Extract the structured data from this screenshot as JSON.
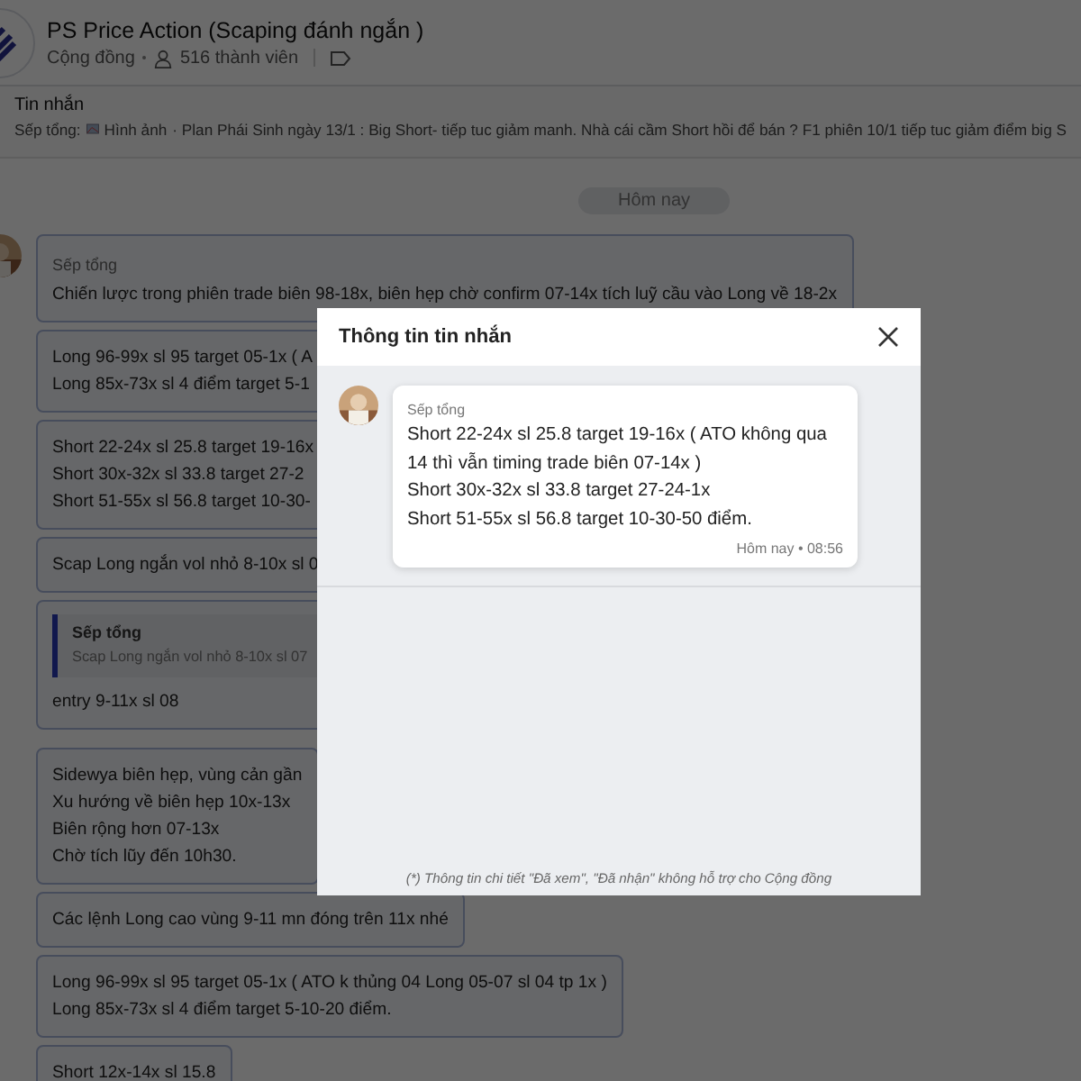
{
  "header": {
    "title": "PS Price Action (Scaping đánh ngắn )",
    "type": "Cộng đồng",
    "members": "516 thành viên"
  },
  "pinned": {
    "label": "Tin nhắn",
    "sender": "Sếp tổng:",
    "attachment": "Hình ảnh",
    "preview": "· Plan Phái Sinh ngày 13/1 : Big Short- tiếp tuc giảm manh. Nhà cái cầm Short hồi để bán ?  F1 phiên 10/1 tiếp tuc giảm điểm big S"
  },
  "date_divider": "Hôm nay",
  "messages": [
    {
      "kind": "text",
      "sender": "Sếp tổng",
      "lines": [
        "Chiến lược trong phiên trade biên 98-18x, biên hẹp chờ confirm 07-14x tích luỹ cầu vào Long về 18-2x"
      ]
    },
    {
      "kind": "text",
      "lines": [
        "Long 96-99x sl 95 target 05-1x ( A",
        "Long 85x-73x sl 4 điểm target 5-1"
      ]
    },
    {
      "kind": "text",
      "lines": [
        "Short 22-24x sl 25.8 target 19-16x",
        "Short 30x-32x sl 33.8 target 27-2",
        "Short 51-55x sl 56.8 target 10-30-"
      ]
    },
    {
      "kind": "text",
      "lines": [
        "Scap Long ngắn vol nhỏ 8-10x sl 0"
      ]
    },
    {
      "kind": "reply",
      "quote_sender": "Sếp tổng",
      "quote_text": "Scap Long ngắn vol nhỏ 8-10x sl 07",
      "lines": [
        "entry 9-11x sl 08"
      ]
    },
    {
      "kind": "text",
      "lines": [
        "Sidewya biên hẹp, vùng cản gần",
        "Xu hướng về biên hẹp 10x-13x",
        "Biên rộng hơn 07-13x",
        "Chờ tích lũy đến 10h30."
      ]
    },
    {
      "kind": "text",
      "lines": [
        "Các lệnh Long cao vùng 9-11 mn đóng trên 11x nhé"
      ]
    },
    {
      "kind": "text",
      "lines": [
        "Long 96-99x sl 95 target 05-1x ( ATO k thủng 04 Long 05-07 sl 04 tp 1x )",
        "Long 85x-73x sl 4 điểm target 5-10-20 điểm."
      ]
    },
    {
      "kind": "text",
      "lines": [
        "Short 12x-14x sl 15.8"
      ]
    }
  ],
  "modal": {
    "title": "Thông tin tin nhắn",
    "message": {
      "sender": "Sếp tổng",
      "lines": [
        "Short 22-24x sl 25.8 target 19-16x ( ATO không qua 14 thì vẫn timing trade biên 07-14x )",
        "Short 30x-32x sl 33.8 target 27-24-1x",
        "Short 51-55x sl 56.8 target 10-30-50 điểm."
      ],
      "time": "Hôm nay • 08:56"
    },
    "footnote": "(*) Thông tin chi tiết \"Đã xem\", \"Đã nhận\" không hỗ trợ cho Cộng đồng"
  }
}
